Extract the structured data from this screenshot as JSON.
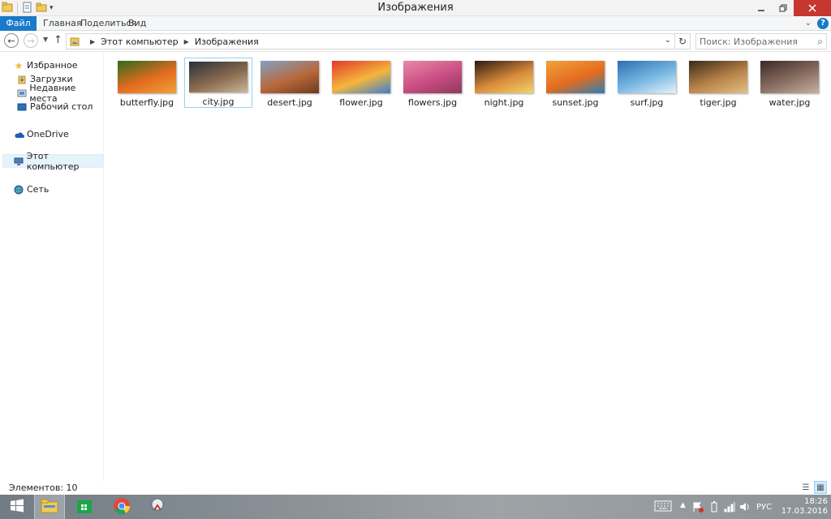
{
  "window": {
    "title": "Изображения"
  },
  "ribbon": {
    "tabs": [
      "Файл",
      "Главная",
      "Поделиться",
      "Вид"
    ]
  },
  "address": {
    "breadcrumb": [
      "Этот компьютер",
      "Изображения"
    ],
    "search_placeholder": "Поиск: Изображения"
  },
  "sidebar": {
    "items": [
      {
        "label": "Избранное",
        "icon": "star-icon"
      },
      {
        "label": "Загрузки",
        "icon": "downloads-icon"
      },
      {
        "label": "Недавние места",
        "icon": "recent-places-icon"
      },
      {
        "label": "Рабочий стол",
        "icon": "desktop-icon"
      },
      {
        "label": "OneDrive",
        "icon": "cloud-icon"
      },
      {
        "label": "Этот компьютер",
        "icon": "computer-icon"
      },
      {
        "label": "Сеть",
        "icon": "network-icon"
      }
    ]
  },
  "files": [
    {
      "name": "butterfly.jpg",
      "colors": [
        "#2f6b1e",
        "#e46b1f",
        "#f0a23a"
      ]
    },
    {
      "name": "city.jpg",
      "colors": [
        "#27313b",
        "#8a6b4e",
        "#c9b79a"
      ],
      "selected": true
    },
    {
      "name": "desert.jpg",
      "colors": [
        "#7fa2c6",
        "#b9683a",
        "#6e3a1e"
      ]
    },
    {
      "name": "flower.jpg",
      "colors": [
        "#e2392b",
        "#f4b63b",
        "#3a7fd0"
      ]
    },
    {
      "name": "flowers.jpg",
      "colors": [
        "#e98aa8",
        "#c94c82",
        "#8e3b5c"
      ]
    },
    {
      "name": "night.jpg",
      "colors": [
        "#2a1a12",
        "#d98b3a",
        "#f2d46a"
      ]
    },
    {
      "name": "sunset.jpg",
      "colors": [
        "#f0a23a",
        "#e46b1f",
        "#2b7fb5"
      ]
    },
    {
      "name": "surf.jpg",
      "colors": [
        "#2c6fb3",
        "#7ab9e2",
        "#e8f2fa"
      ]
    },
    {
      "name": "tiger.jpg",
      "colors": [
        "#3a2a1a",
        "#b98448",
        "#e0c089"
      ]
    },
    {
      "name": "water.jpg",
      "colors": [
        "#3b2a26",
        "#8a6e62",
        "#c9b0a2"
      ]
    }
  ],
  "status": {
    "text": "Элементов: 10"
  },
  "taskbar": {
    "language": "РУС",
    "time": "18:26",
    "date": "17.03.2016"
  }
}
